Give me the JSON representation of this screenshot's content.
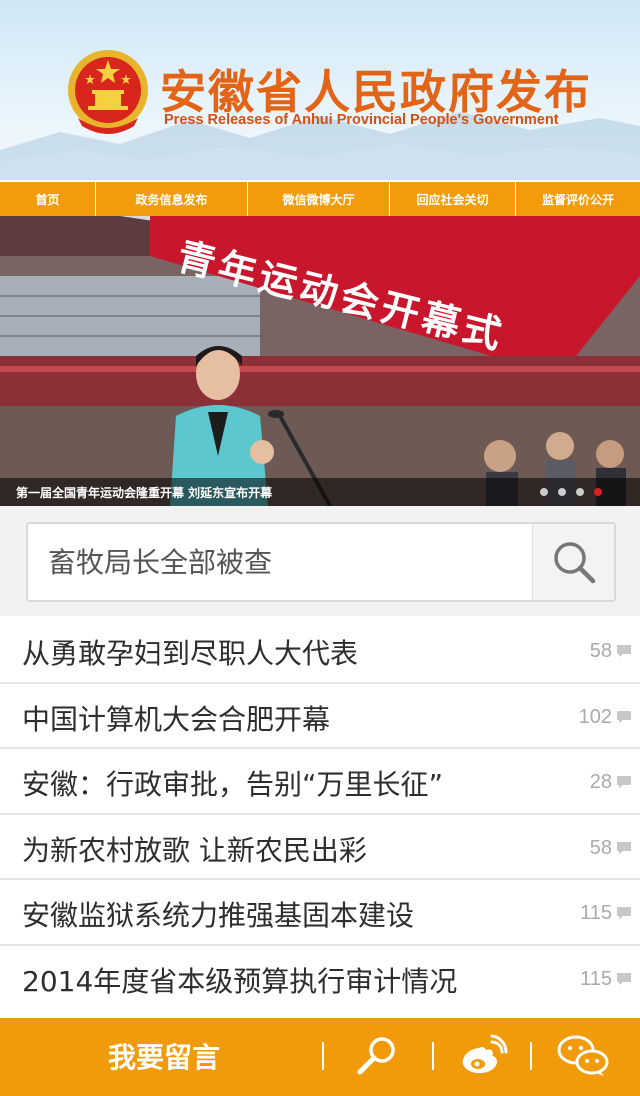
{
  "header": {
    "title_cn": "安徽省人民政府发布",
    "title_en": "Press Releases of Anhui Provincial People's Government",
    "emblem_icon": "national-emblem-icon"
  },
  "nav": {
    "items": [
      {
        "label": "首页"
      },
      {
        "label": "政务信息发布"
      },
      {
        "label": "微信微博大厅"
      },
      {
        "label": "回应社会关切"
      },
      {
        "label": "监督评价公开"
      }
    ]
  },
  "banner": {
    "banner_text": "青年运动会开幕式",
    "caption": "第一届全国青年运动会隆重开幕  刘延东宣布开幕",
    "slide_count": 4,
    "active_slide": 4
  },
  "search": {
    "placeholder": "畜牧局长全部被查",
    "icon": "search-icon"
  },
  "news": [
    {
      "title": "从勇敢孕妇到尽职人大代表",
      "comments": "58"
    },
    {
      "title": "中国计算机大会合肥开幕",
      "comments": "102"
    },
    {
      "title": "安徽：行政审批，告别“万里长征”",
      "comments": "28"
    },
    {
      "title": "为新农村放歌  让新农民出彩",
      "comments": "58"
    },
    {
      "title": "安徽监狱系统力推强基固本建设",
      "comments": "115"
    },
    {
      "title": "2014年度省本级预算执行审计情况",
      "comments": "115"
    }
  ],
  "bottom_bar": {
    "leave_message": "我要留言",
    "icons": [
      "search-icon",
      "weibo-icon",
      "wechat-icon"
    ]
  },
  "colors": {
    "accent": "#f29c0b",
    "title": "#e26418",
    "active_dot": "#e02020"
  }
}
